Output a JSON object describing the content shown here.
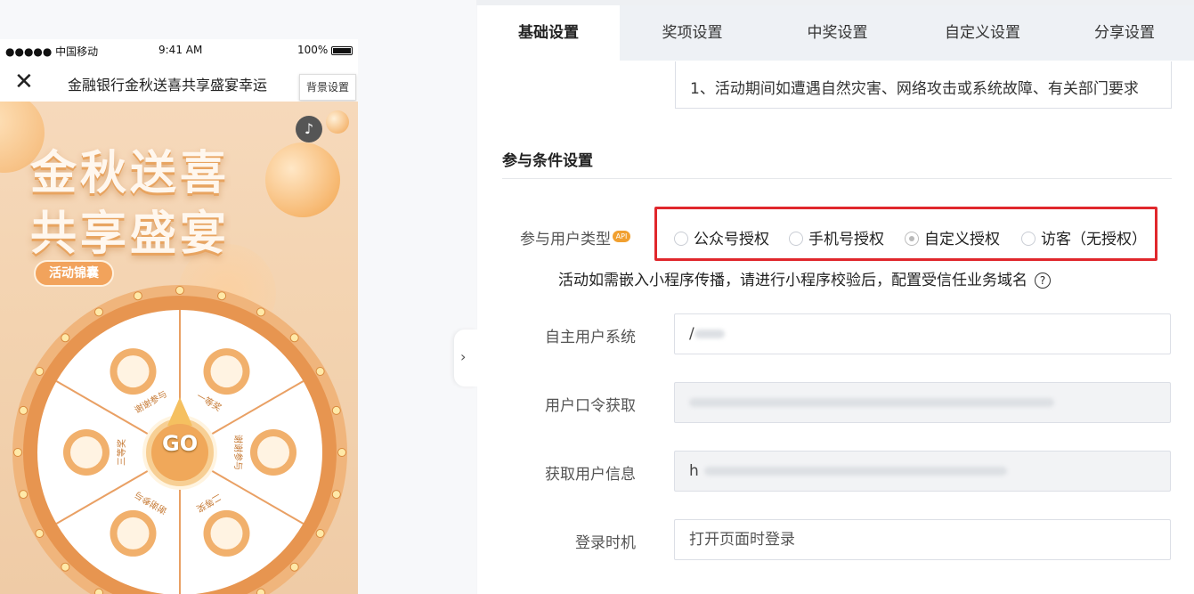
{
  "phone": {
    "status": {
      "carrier": "●●●●● 中国移动",
      "time": "9:41 AM",
      "battery": "100%"
    },
    "nav_title": "金融银行金秋送喜共享盛宴幸运",
    "bg_button": "背景设置",
    "music_icon": "♪",
    "headline_1": "金秋送喜",
    "headline_2": "共享盛宴",
    "rules_pill": "活动锦囊",
    "wheel": {
      "go": "GO",
      "sectors": [
        "谢谢参与",
        "一等奖",
        "谢谢参与",
        "二等奖",
        "谢谢参与",
        "三等奖"
      ]
    }
  },
  "tabs": [
    "基础设置",
    "奖项设置",
    "中奖设置",
    "自定义设置",
    "分享设置"
  ],
  "active_tab": "基础设置",
  "description_text": "1、活动期间如遭遇自然灾害、网络攻击或系统故障、有关部门要求",
  "section_title": "参与条件设置",
  "user_type": {
    "label": "参与用户类型",
    "badge": "API",
    "options": [
      "公众号授权",
      "手机号授权",
      "自定义授权",
      "访客（无授权）"
    ],
    "selected": "自定义授权"
  },
  "hint": "活动如需嵌入小程序传播，请进行小程序校验后，配置受信任业务域名",
  "fields": {
    "self_user_system": {
      "label": "自主用户系统",
      "value": "/"
    },
    "token_fetch": {
      "label": "用户口令获取",
      "value": ""
    },
    "user_info": {
      "label": "获取用户信息",
      "value": "h"
    },
    "login_timing": {
      "label": "登录时机",
      "placeholder": "打开页面时登录"
    }
  },
  "collapse_arrow": "›",
  "colors": {
    "accent_red": "#e0272c",
    "wheel_orange": "#f2a35c",
    "badge": "#f1a030"
  }
}
